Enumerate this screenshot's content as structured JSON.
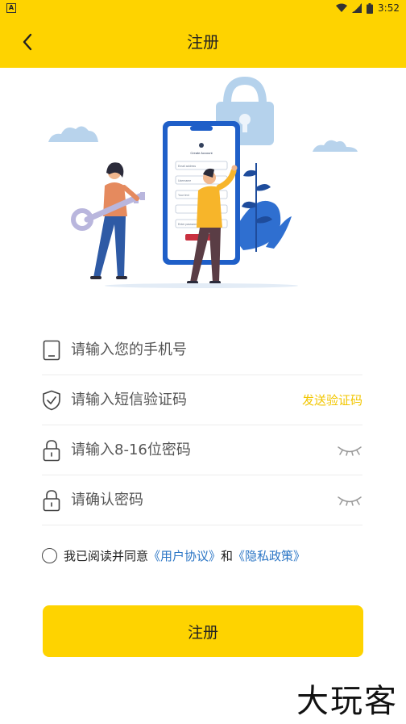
{
  "status_bar": {
    "app_badge": "A",
    "time": "3:52"
  },
  "header": {
    "title": "注册"
  },
  "form": {
    "phone": {
      "placeholder": "请输入您的手机号"
    },
    "code": {
      "placeholder": "请输入短信验证码",
      "send_label": "发送验证码"
    },
    "password": {
      "placeholder": "请输入8-16位密码"
    },
    "confirm": {
      "placeholder": "请确认密码"
    }
  },
  "agreement": {
    "prefix": "我已阅读并同意",
    "user_agreement": "《用户协议》",
    "and": "和",
    "privacy_policy": "《隐私政策》"
  },
  "submit_label": "注册",
  "watermark": "大玩客",
  "illustration": {
    "screen_title": "Create Account",
    "fields": [
      "Email address",
      "Username",
      "Your text",
      "Enter password"
    ]
  },
  "colors": {
    "accent": "#fed300",
    "link": "#2a75c5",
    "send_code": "#f2c600"
  }
}
